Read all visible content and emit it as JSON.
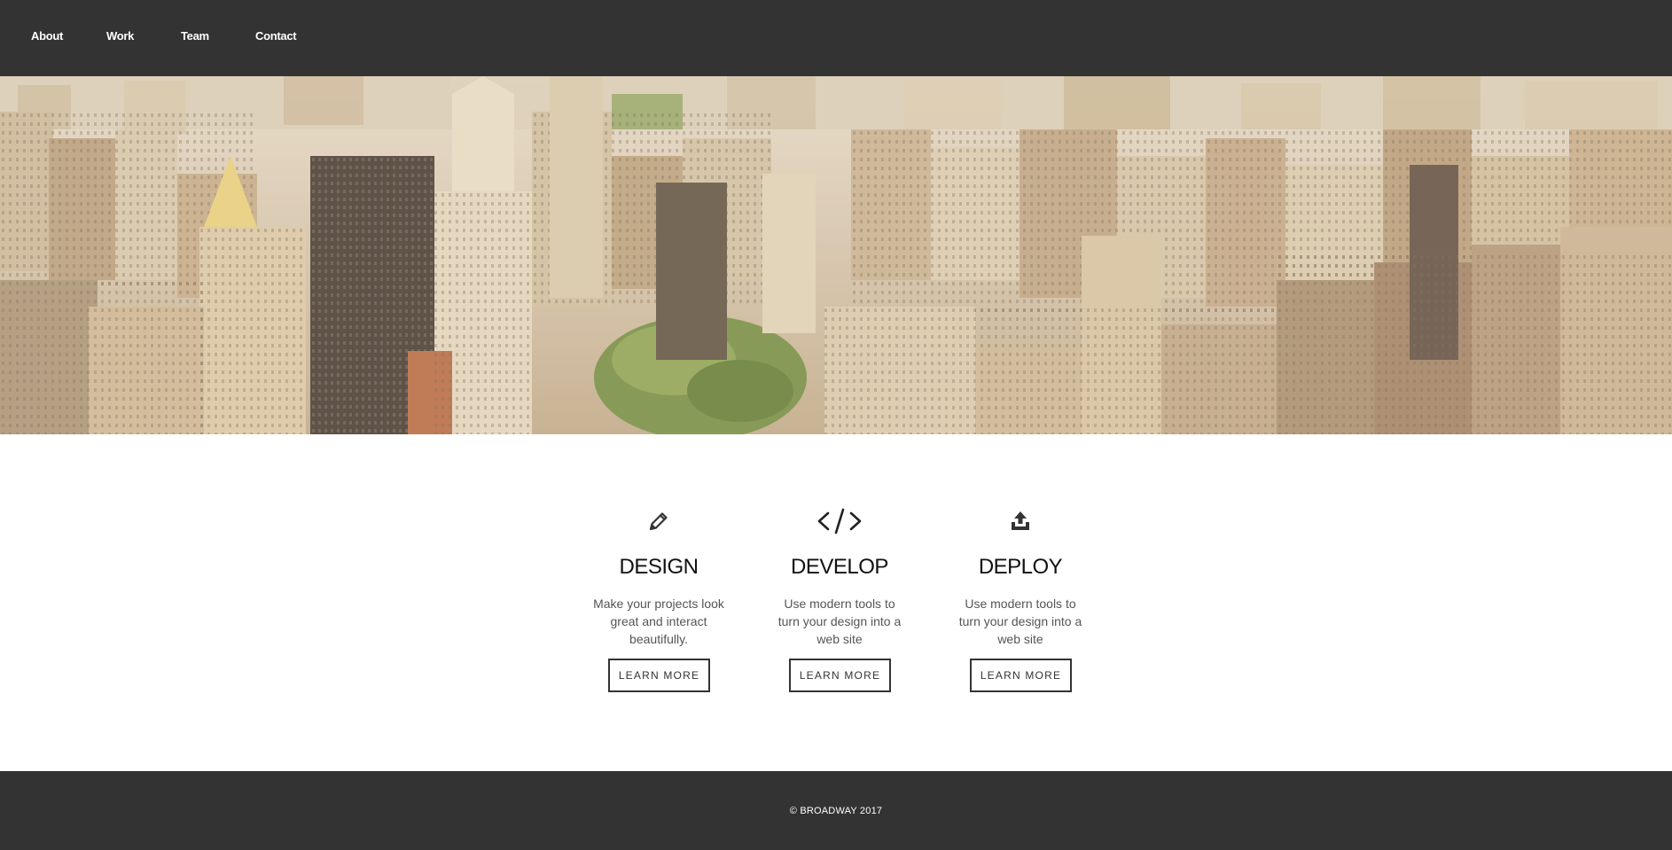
{
  "nav": {
    "items": [
      {
        "label": "About"
      },
      {
        "label": "Work"
      },
      {
        "label": "Team"
      },
      {
        "label": "Contact"
      }
    ]
  },
  "hero": {
    "image": "city-aerial-photo"
  },
  "features": [
    {
      "icon": "pencil-icon",
      "title": "DESIGN",
      "description": "Make your projects look great and interact beautifully.",
      "button": "LEARN MORE"
    },
    {
      "icon": "code-icon",
      "title": "DEVELOP",
      "description": "Use modern tools to turn your design into a web site",
      "button": "LEARN MORE"
    },
    {
      "icon": "upload-icon",
      "title": "DEPLOY",
      "description": "Use modern tools to turn your design into a web site",
      "button": "LEARN MORE"
    }
  ],
  "footer": {
    "copyright": "© BROADWAY 2017"
  },
  "colors": {
    "nav_bg": "#333333",
    "footer_bg": "#333333",
    "text_dark": "#111111",
    "button_border": "#333333"
  }
}
